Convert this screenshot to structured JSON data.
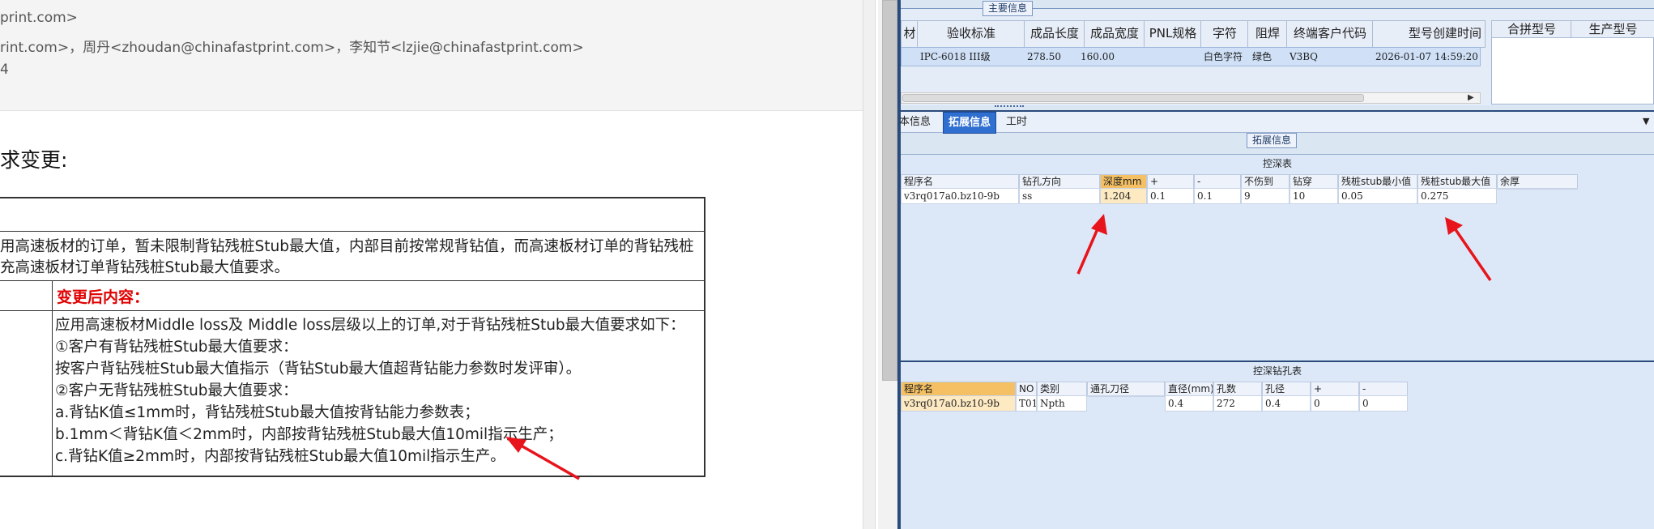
{
  "email": {
    "header_lines": [
      "print.com>",
      "rint.com>，周丹<zhoudan@chinafastprint.com>，李知节<lzjie@chinafastprint.com>",
      "4"
    ],
    "section_title": "求变更:",
    "table": {
      "before_text_1": "用高速板材的订单，暂未限制背钻残桩Stub最大值，内部目前按常规背钻值，而高速板材订单的背钻残桩",
      "before_text_2": "充高速板材订单背钻残桩Stub最大值要求。",
      "after_label": "变更后内容：",
      "after_lines": [
        "应用高速板材Middle loss及 Middle loss层级以上的订单,对于背钻残桩Stub最大值要求如下：",
        "①客户有背钻残桩Stub最大值要求：",
        " 按客户背钻残桩Stub最大值指示（背钻Stub最大值超背钻能力参数时发评审）。",
        "②客户无背钻残桩Stub最大值要求：",
        " a.背钻K值≤1mm时，背钻残桩Stub最大值按背钻能力参数表；",
        " b.1mm＜背钻K值＜2mm时，内部按背钻残桩Stub最大值10mil指示生产；",
        " c.背钻K值≥2mm时，内部按背钻残桩Stub最大值10mil指示生产。"
      ]
    }
  },
  "erp": {
    "main_group_label": "主要信息",
    "main_columns": [
      "材",
      "验收标准",
      "成品长度",
      "成品宽度",
      "PNL规格",
      "字符",
      "阻焊",
      "终端客户代码",
      "型号创建时间"
    ],
    "main_row": [
      "",
      "IPC-6018 III级",
      "278.50",
      "160.00",
      "",
      "白色字符",
      "绿色",
      "V3BQ",
      "2026-01-07 14:59:20"
    ],
    "side_columns": [
      "合拼型号",
      "生产型号"
    ],
    "tabs": [
      "本信息",
      "拓展信息",
      "工时"
    ],
    "active_tab": "拓展信息",
    "ext_group_label": "拓展信息",
    "depth_table": {
      "title": "控深表",
      "columns": [
        "程序名",
        "钻孔方向",
        "深度mm",
        "+",
        "-",
        "不伤到",
        "钻穿",
        "残桩stub最小值",
        "残桩stub最大值",
        "余厚"
      ],
      "row": [
        "v3rq017a0.bz10-9b",
        "ss",
        "1.204",
        "0.1",
        "0.1",
        "9",
        "10",
        "0.05",
        "0.275",
        ""
      ]
    },
    "drill_table": {
      "title": "控深钻孔表",
      "columns": [
        "程序名",
        "NO",
        "类别",
        "通孔刀径",
        "直径(mm)",
        "孔数",
        "孔径",
        "+",
        "-"
      ],
      "row": [
        "v3rq017a0.bz10-9b",
        "T01",
        "Npth",
        "",
        "0.4",
        "272",
        "0.4",
        "0",
        "0"
      ]
    },
    "highlight_color": "#f5c063",
    "annotation_color": "#e8141b"
  }
}
